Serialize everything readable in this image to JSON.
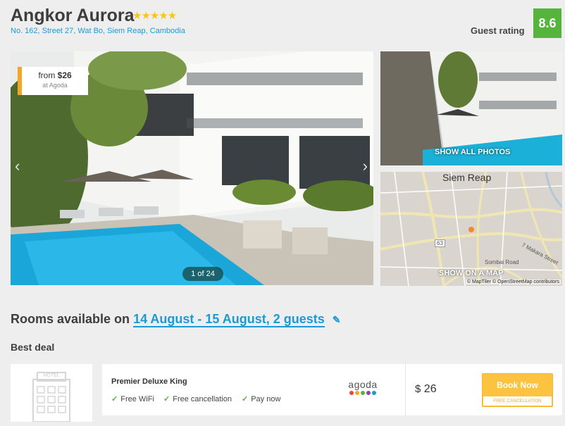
{
  "header": {
    "hotel_name": "Angkor Aurora",
    "stars": "★★★★★",
    "address": "No. 162, Street 27, Wat Bo, Siem Reap, Cambodia",
    "rating_label": "Guest rating",
    "rating_value": "8.6"
  },
  "gallery": {
    "price_from": "from",
    "price_value": "$26",
    "price_source": "at Agoda",
    "counter": "1 of 24",
    "prev_arrow": "‹",
    "next_arrow": "›",
    "show_all_photos": "SHOW ALL PHOTOS",
    "map_city": "Siem Reap",
    "map_road_label": "63",
    "map_street_1": "Sombai Road",
    "map_street_2": "7 Makara Street",
    "show_on_map": "SHOW ON A MAP",
    "map_attribution": "© MapTiler © OpenStreetMap contributors"
  },
  "rooms": {
    "title_prefix": "Rooms available on",
    "date_range": "14 August - 15 August, 2 guests",
    "edit_icon": "✎",
    "best_deal": "Best deal"
  },
  "deal": {
    "thumb_label": "HOTEL",
    "room_name": "Premier Deluxe King",
    "features": [
      "Free WiFi",
      "Free cancellation",
      "Pay now"
    ],
    "check_icon": "✓",
    "provider": "agoda",
    "provider_dots": [
      "#e8453c",
      "#f5a623",
      "#55b43c",
      "#8e44ad",
      "#1a9bd7"
    ],
    "currency": "$",
    "price": "26",
    "book_label": "Book Now",
    "cancel_note": "FREE CANCELLATION"
  },
  "colors": {
    "accent_blue": "#1a9bd7",
    "rating_green": "#55b43c",
    "book_yellow": "#fbc33f",
    "star_yellow": "#fcc419"
  }
}
